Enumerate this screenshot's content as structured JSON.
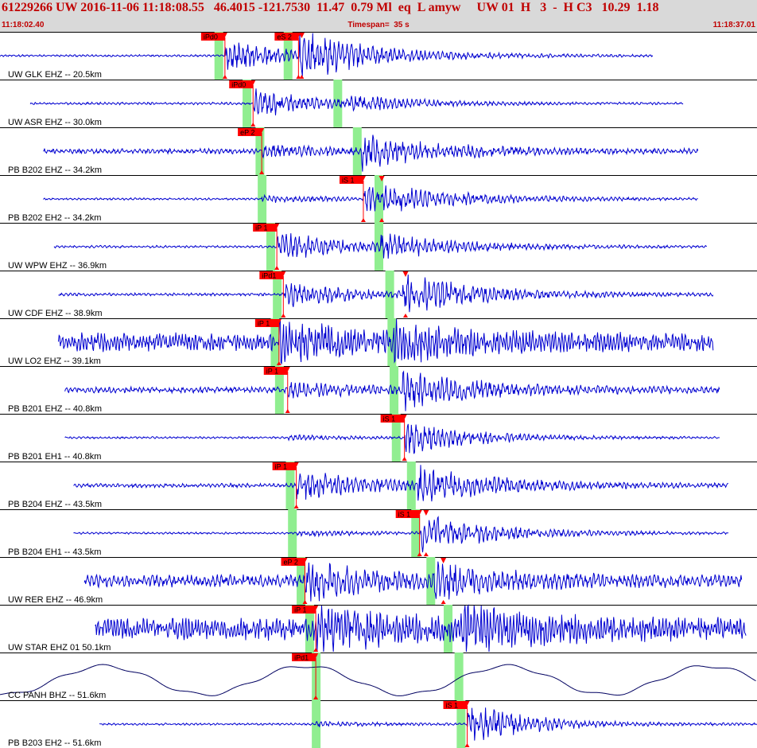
{
  "header": {
    "event_line": "61229266 UW 2016-11-06 11:18:08.55   46.4015 -121.7530  11.47  0.79 Ml  eq  L amyw     UW 01  H   3  -  H C3   10.29  1.18",
    "start_time": "11:18:02.40",
    "end_time": "11:18:37.01",
    "timespan_label": "Timespan=  35 s"
  },
  "colors": {
    "header_bg": "#d9d9d9",
    "header_text": "#c00000",
    "trace": "#0000d0",
    "broadband_trace": "#000060",
    "pick_window": "#90ee90",
    "pick": "#ff0000",
    "pick_label_text": "#000000",
    "channel_label": "#000000"
  },
  "chart_data": {
    "type": "line",
    "title": "",
    "xlabel": "",
    "ylabel": "",
    "xlim_seconds": [
      0,
      35
    ],
    "series": [
      {
        "channel": "UW GLK EHZ -- 20.5km",
        "p_label": "iPd0",
        "p_time": 10.4,
        "s_label": "eS 2",
        "s_time": 13.8,
        "wave": {
          "start": 0.0,
          "end": 30.2,
          "p_arr": 10.4,
          "s_arr": 13.8,
          "noise": 0.05,
          "p_amp": 0.7,
          "s_amp": 0.95,
          "coda": 3.5,
          "period": 0.2
        },
        "markers": [
          {
            "time": 13.95,
            "label": ""
          }
        ],
        "greens": [
          10.1,
          13.3
        ]
      },
      {
        "channel": "UW ASR EHZ -- 30.0km",
        "p_label": "iPd0",
        "p_time": 11.7,
        "s_label": "",
        "s_time": null,
        "wave": {
          "start": 1.4,
          "end": 31.6,
          "p_arr": 11.7,
          "s_arr": 16.2,
          "noise": 0.06,
          "p_amp": 0.7,
          "s_amp": 0.3,
          "coda": 3.0,
          "period": 0.2
        },
        "markers": [],
        "greens": [
          11.4,
          15.6
        ]
      },
      {
        "channel": "PB B202 EHZ -- 34.2km",
        "p_label": "eP 2",
        "p_time": 12.1,
        "s_label": "",
        "s_time": null,
        "wave": {
          "start": 2.0,
          "end": 32.3,
          "p_arr": 12.1,
          "s_arr": 16.7,
          "noise": 0.12,
          "p_amp": 0.3,
          "s_amp": 0.75,
          "coda": 3.5,
          "period": 0.2
        },
        "markers": [],
        "greens": [
          12.0,
          16.5
        ]
      },
      {
        "channel": "PB B202 EH2 -- 34.2km",
        "p_label": "",
        "p_time": null,
        "s_label": "iS 1",
        "s_time": 16.8,
        "wave": {
          "start": 2.0,
          "end": 32.3,
          "p_arr": 12.1,
          "s_arr": 16.8,
          "noise": 0.05,
          "p_amp": 0.15,
          "s_amp": 0.8,
          "coda": 4.0,
          "period": 0.2
        },
        "markers": [
          {
            "time": 17.65,
            "label": ""
          }
        ],
        "greens": [
          12.1,
          17.5
        ]
      },
      {
        "channel": "UW WPW EHZ -- 36.9km",
        "p_label": "iP 1",
        "p_time": 12.8,
        "s_label": "",
        "s_time": null,
        "wave": {
          "start": 2.5,
          "end": 32.7,
          "p_arr": 12.8,
          "s_arr": 17.6,
          "noise": 0.06,
          "p_amp": 0.7,
          "s_amp": 0.5,
          "coda": 3.5,
          "period": 0.2
        },
        "markers": [],
        "greens": [
          12.5,
          17.5
        ]
      },
      {
        "channel": "UW CDF EHZ -- 38.9km",
        "p_label": "iPd1",
        "p_time": 13.1,
        "s_label": "",
        "s_time": null,
        "wave": {
          "start": 2.7,
          "end": 33.0,
          "p_arr": 13.1,
          "s_arr": 18.6,
          "noise": 0.07,
          "p_amp": 0.6,
          "s_amp": 0.9,
          "coda": 3.5,
          "period": 0.2
        },
        "markers": [
          {
            "time": 18.75,
            "label": ""
          }
        ],
        "greens": [
          12.8,
          18.0
        ]
      },
      {
        "channel": "UW LO2 EHZ -- 39.1km",
        "p_label": "iP 1",
        "p_time": 12.9,
        "s_label": "",
        "s_time": null,
        "wave": {
          "start": 2.7,
          "end": 33.0,
          "p_arr": 12.9,
          "s_arr": 18.2,
          "noise": 0.45,
          "p_amp": 0.95,
          "s_amp": 0.65,
          "coda": 3.0,
          "period": 0.15
        },
        "markers": [],
        "greens": [
          12.7,
          18.1
        ]
      },
      {
        "channel": "PB B201 EHZ -- 40.8km",
        "p_label": "iP 1",
        "p_time": 13.3,
        "s_label": "",
        "s_time": null,
        "wave": {
          "start": 3.0,
          "end": 33.3,
          "p_arr": 13.3,
          "s_arr": 18.6,
          "noise": 0.15,
          "p_amp": 0.3,
          "s_amp": 0.8,
          "coda": 3.5,
          "period": 0.2
        },
        "markers": [],
        "greens": [
          12.9,
          18.2
        ]
      },
      {
        "channel": "PB B201 EH1 -- 40.8km",
        "p_label": "",
        "p_time": null,
        "s_label": "iS 1",
        "s_time": 18.7,
        "wave": {
          "start": 3.0,
          "end": 33.3,
          "p_arr": 13.3,
          "s_arr": 18.7,
          "noise": 0.05,
          "p_amp": 0.1,
          "s_amp": 0.85,
          "coda": 3.0,
          "period": 0.2
        },
        "markers": [],
        "greens": [
          18.3
        ]
      },
      {
        "channel": "PB B204 EHZ -- 43.5km",
        "p_label": "iP 1",
        "p_time": 13.7,
        "s_label": "",
        "s_time": null,
        "wave": {
          "start": 3.4,
          "end": 33.7,
          "p_arr": 13.7,
          "s_arr": 19.3,
          "noise": 0.1,
          "p_amp": 0.7,
          "s_amp": 0.8,
          "coda": 3.5,
          "period": 0.2
        },
        "markers": [],
        "greens": [
          13.4,
          19.0
        ]
      },
      {
        "channel": "PB B204 EH1 -- 43.5km",
        "p_label": "",
        "p_time": null,
        "s_label": "iS 1",
        "s_time": 19.4,
        "wave": {
          "start": 3.4,
          "end": 33.7,
          "p_arr": 13.7,
          "s_arr": 19.4,
          "noise": 0.05,
          "p_amp": 0.12,
          "s_amp": 0.9,
          "coda": 3.5,
          "period": 0.2
        },
        "markers": [
          {
            "time": 19.7,
            "label": ""
          }
        ],
        "greens": [
          13.5,
          19.2
        ]
      },
      {
        "channel": "UW RER EHZ -- 46.9km",
        "p_label": "eP 2",
        "p_time": 14.1,
        "s_label": "",
        "s_time": null,
        "wave": {
          "start": 3.9,
          "end": 34.3,
          "p_arr": 14.1,
          "s_arr": 20.0,
          "noise": 0.3,
          "p_amp": 0.8,
          "s_amp": 0.7,
          "coda": 3.0,
          "period": 0.2
        },
        "markers": [
          {
            "time": 20.5,
            "label": ""
          }
        ],
        "greens": [
          13.9,
          19.9
        ]
      },
      {
        "channel": "UW STAR EHZ 01 50.1km",
        "p_label": "iP 1",
        "p_time": 14.6,
        "s_label": "",
        "s_time": null,
        "wave": {
          "start": 4.4,
          "end": 34.5,
          "p_arr": 14.6,
          "s_arr": 21.3,
          "noise": 0.55,
          "p_amp": 0.9,
          "s_amp": 0.9,
          "coda": 3.0,
          "period": 0.15
        },
        "markers": [],
        "greens": [
          14.3,
          20.7
        ]
      },
      {
        "channel": "CC PANH BHZ -- 51.6km",
        "p_label": "iPd1",
        "p_time": 14.6,
        "s_label": "",
        "s_time": null,
        "wave": {
          "start": 0.0,
          "end": 35.0,
          "p_arr": 14.6,
          "s_arr": 21.3,
          "noise": 0.0,
          "p_amp": 0.0,
          "s_amp": 0.0,
          "coda": 1.0,
          "period": 0.2,
          "broadband": true
        },
        "markers": [],
        "greens": [
          14.6,
          21.2
        ]
      },
      {
        "channel": "PB B203 EH2 -- 51.6km",
        "p_label": "",
        "p_time": null,
        "s_label": "iS 1",
        "s_time": 21.6,
        "wave": {
          "start": 4.6,
          "end": 35.0,
          "p_arr": 14.6,
          "s_arr": 21.6,
          "noise": 0.05,
          "p_amp": 0.1,
          "s_amp": 0.95,
          "coda": 3.0,
          "period": 0.2
        },
        "markers": [],
        "greens": [
          14.6,
          21.3
        ]
      }
    ]
  }
}
